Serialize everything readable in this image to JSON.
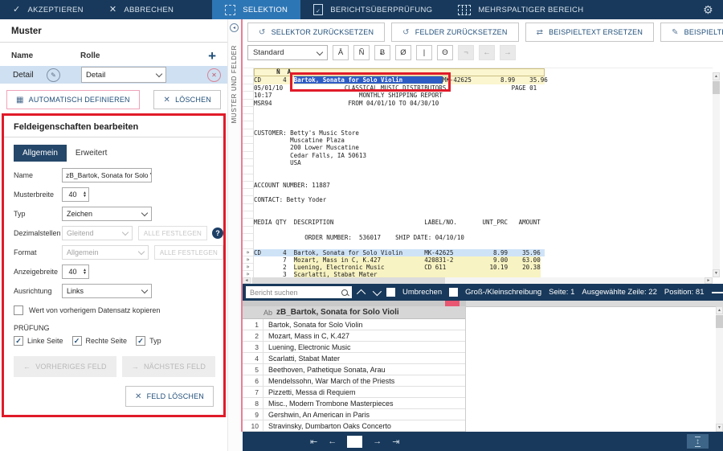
{
  "icons": {
    "check": "✓",
    "close": "✕",
    "gear": "⚙",
    "reset": "↺",
    "replace": "⇄",
    "redact": "✎",
    "define": "▦",
    "plus": "+",
    "edit": "✎",
    "remove": "✕",
    "help": "?",
    "up": "▲",
    "down": "▼",
    "left_arrow": "←",
    "right_arrow": "→",
    "first": "⇤",
    "prev": "←",
    "next": "→",
    "last": "⇥",
    "marker": "»",
    "expand": "↕",
    "collapse": "◂",
    "scroll_up": "▲",
    "scroll_down": "▼",
    "scroll_left": "◄",
    "scroll_right": "►"
  },
  "colors": {
    "navy": "#18395b",
    "tab_blue": "#2d76b5",
    "accent_blue": "#1f4e79",
    "selection_blue": "#2e5cc5",
    "annotation_red": "#e01b29",
    "pink_border": "#efa3b9",
    "splitter_pink": "#e97f95",
    "highlight_yellow": "#fbf6cf",
    "field_yellow": "#f8f3c2",
    "selected_row_blue": "#cfe3f7",
    "slider_dot": "#ee4b6a"
  },
  "topbar": {
    "accept": "AKZEPTIEREN",
    "cancel": "ABBRECHEN",
    "tabs": [
      {
        "label": "SELEKTION",
        "active": true
      },
      {
        "label": "BERICHTSÜBERPRÜFUNG",
        "active": false
      },
      {
        "label": "MEHRSPALTIGER BEREICH",
        "active": false
      }
    ]
  },
  "muster": {
    "title": "Muster",
    "col_name": "Name",
    "col_role": "Rolle",
    "row": {
      "name": "Detail",
      "role": "Detail"
    },
    "auto_define": "AUTOMATISCH DEFINIEREN",
    "delete": "LÖSCHEN",
    "side_strip": "MUSTER UND FELDER"
  },
  "field_props": {
    "title": "Feldeigenschaften bearbeiten",
    "tab_general": "Allgemein",
    "tab_advanced": "Erweitert",
    "name_label": "Name",
    "name_value": "zB_Bartok, Sonata for Solo Violi",
    "pattern_width_label": "Musterbreite",
    "pattern_width_value": "40",
    "type_label": "Typ",
    "type_value": "Zeichen",
    "decimals_label": "Dezimalstellen",
    "decimals_value": "Gleitend",
    "set_all": "ALLE FESTLEGEN",
    "format_label": "Format",
    "format_value": "Allgemein",
    "display_width_label": "Anzeigebreite",
    "display_width_value": "40",
    "align_label": "Ausrichtung",
    "align_value": "Links",
    "copy_checkbox": "Wert von vorherigem Datensatz kopieren",
    "check_section": "PRÜFUNG",
    "checks": [
      "Linke Seite",
      "Rechte Seite",
      "Typ"
    ],
    "prev_field": "VORHERIGES FELD",
    "next_field": "NÄCHSTES FELD",
    "delete_field": "FELD LÖSCHEN"
  },
  "selector_toolbar": {
    "buttons": [
      "SELEKTOR ZURÜCKSETZEN",
      "FELDER ZURÜCKSETZEN",
      "BEISPIELTEXT ERSETZEN",
      "BEISPIELTEXT SCHWÄRZEN"
    ]
  },
  "format_toolbar": {
    "preset": "Standard",
    "traps": [
      "Ā",
      "Ñ",
      "Ƀ",
      "Ø",
      "|",
      "Θ"
    ],
    "disabled": [
      "¬",
      "←",
      "→"
    ]
  },
  "report": {
    "selector_row": "      Ñ  Ā",
    "sample": {
      "pre": "CD      4  ",
      "field": "Bartok, Sonata for Solo Violin           ",
      "post": "MK-42625        8.99    35.96"
    },
    "selected_line_index": 22,
    "field_lines": [
      23,
      24,
      25
    ],
    "marker_cells": [
      24,
      25,
      26,
      27
    ],
    "marker": "»",
    "lines": [
      "05/01/10                 CLASSICAL MUSIC DISTRIBUTORS                  PAGE 01",
      "10:17                        MONTHLY SHIPPING REPORT",
      "MSR94                     FROM 04/01/10 TO 04/30/10",
      "",
      "",
      "",
      "CUSTOMER: Betty's Music Store",
      "          Muscatine Plaza",
      "          200 Lower Muscatine",
      "          Cedar Falls, IA 50613",
      "          USA",
      "",
      "",
      "ACCOUNT NUMBER: 11887",
      "",
      "CONTACT: Betty Yoder",
      "",
      "",
      "MEDIA QTY  DESCRIPTION                         LABEL/NO.       UNT_PRC   AMOUNT",
      "",
      "              ORDER NUMBER:  536017    SHIP DATE: 04/10/10",
      "",
      "CD      4  Bartok, Sonata for Solo Violin      MK-42625           8.99    35.96",
      "        7  Mozart, Mass in C, K.427            420831-2           9.00    63.00",
      "        2  Luening, Electronic Music           CD 611            10.19    20.38",
      "        3  Scarlatti, Stabat Mater                                             "
    ]
  },
  "search_bar": {
    "placeholder": "Bericht suchen",
    "wrap": "Umbrechen",
    "case": "Groß-/Kleinschreibung",
    "page": "Seite: 1",
    "selected_line": "Ausgewählte Zeile: 22",
    "position": "Position: 81"
  },
  "results": {
    "header_type": "Ab",
    "header": "zB_Bartok, Sonata for Solo Violi",
    "rows": [
      {
        "num": "1",
        "text": "Bartok, Sonata for Solo Violin"
      },
      {
        "num": "2",
        "text": "Mozart, Mass in C, K.427"
      },
      {
        "num": "3",
        "text": "Luening, Electronic Music"
      },
      {
        "num": "4",
        "text": "Scarlatti, Stabat Mater"
      },
      {
        "num": "5",
        "text": "Beethoven, Pathetique Sonata, Arau"
      },
      {
        "num": "6",
        "text": "Mendelssohn, War March of the Priests"
      },
      {
        "num": "7",
        "text": "Pizzetti, Messa di Requiem"
      },
      {
        "num": "8",
        "text": "Misc., Modern Trombone Masterpieces"
      },
      {
        "num": "9",
        "text": "Gershwin, An American in Paris"
      },
      {
        "num": "10",
        "text": "Stravinsky, Dumbarton Oaks Concerto"
      }
    ]
  }
}
